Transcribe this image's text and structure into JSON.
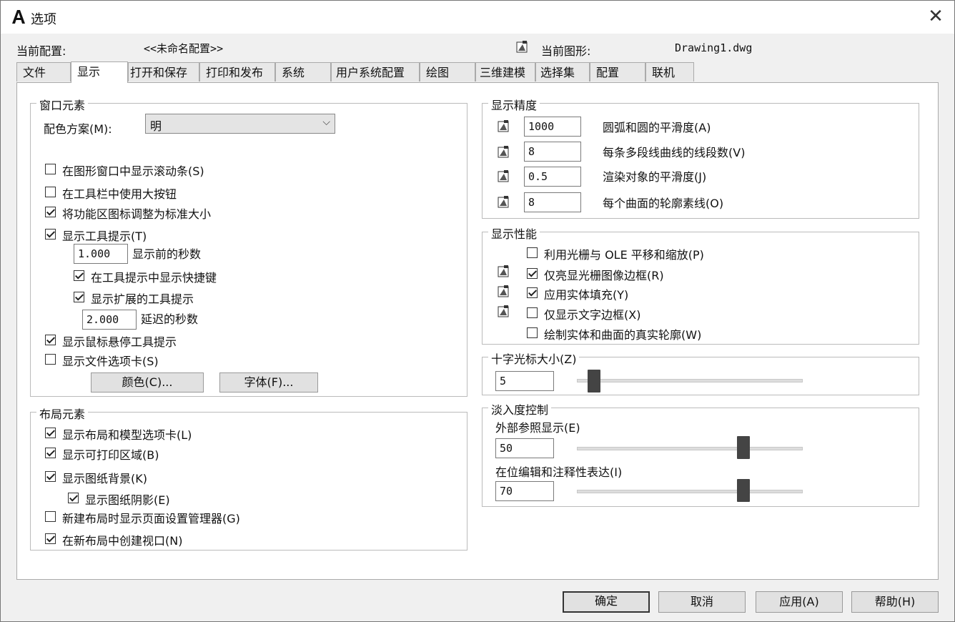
{
  "window": {
    "title": "选项",
    "close": "✕"
  },
  "profile": {
    "label": "当前配置:",
    "value": "<<未命名配置>>",
    "drawing_label": "当前图形:",
    "drawing_value": "Drawing1.dwg"
  },
  "tabs": [
    "文件",
    "显示",
    "打开和保存",
    "打印和发布",
    "系统",
    "用户系统配置",
    "绘图",
    "三维建模",
    "选择集",
    "配置",
    "联机"
  ],
  "active_tab": "显示",
  "window_elements": {
    "title": "窗口元素",
    "color_scheme_label": "配色方案(M):",
    "color_scheme_value": "明",
    "scrollbars": {
      "label": "在图形窗口中显示滚动条(S)",
      "checked": false
    },
    "large_buttons": {
      "label": "在工具栏中使用大按钮",
      "checked": false
    },
    "resize_ribbon_icons": {
      "label": "将功能区图标调整为标准大小",
      "checked": true
    },
    "tooltips": {
      "label": "显示工具提示(T)",
      "checked": true
    },
    "tooltip_delay_value": "1.000",
    "tooltip_delay_label": "显示前的秒数",
    "shortcut_keys": {
      "label": "在工具提示中显示快捷键",
      "checked": true
    },
    "extended_tooltips": {
      "label": "显示扩展的工具提示",
      "checked": true
    },
    "extended_delay_value": "2.000",
    "extended_delay_label": "延迟的秒数",
    "rollover_tooltips": {
      "label": "显示鼠标悬停工具提示",
      "checked": true
    },
    "file_tabs": {
      "label": "显示文件选项卡(S)",
      "checked": false
    },
    "colors_button": "颜色(C)...",
    "fonts_button": "字体(F)..."
  },
  "layout_elements": {
    "title": "布局元素",
    "layout_model_tabs": {
      "label": "显示布局和模型选项卡(L)",
      "checked": true
    },
    "printable_area": {
      "label": "显示可打印区域(B)",
      "checked": true
    },
    "paper_background": {
      "label": "显示图纸背景(K)",
      "checked": true
    },
    "paper_shadow": {
      "label": "显示图纸阴影(E)",
      "checked": true
    },
    "page_setup_manager": {
      "label": "新建布局时显示页面设置管理器(G)",
      "checked": false
    },
    "create_viewport": {
      "label": "在新布局中创建视口(N)",
      "checked": true
    }
  },
  "display_resolution": {
    "title": "显示精度",
    "arc_smoothness": {
      "value": "1000",
      "label": "圆弧和圆的平滑度(A)"
    },
    "polyline_segments": {
      "value": "8",
      "label": "每条多段线曲线的线段数(V)"
    },
    "rendered_smoothness": {
      "value": "0.5",
      "label": "渲染对象的平滑度(J)"
    },
    "contour_lines": {
      "value": "8",
      "label": "每个曲面的轮廓素线(O)"
    }
  },
  "display_performance": {
    "title": "显示性能",
    "raster_ole": {
      "label": "利用光栅与 OLE 平移和缩放(P)",
      "checked": false
    },
    "raster_frame": {
      "label": "仅亮显光栅图像边框(R)",
      "checked": true
    },
    "solid_fill": {
      "label": "应用实体填充(Y)",
      "checked": true
    },
    "text_boundary": {
      "label": "仅显示文字边框(X)",
      "checked": false
    },
    "silhouettes": {
      "label": "绘制实体和曲面的真实轮廓(W)",
      "checked": false
    }
  },
  "crosshair": {
    "title": "十字光标大小(Z)",
    "value": "5",
    "fraction": 0.05
  },
  "fade_control": {
    "title": "淡入度控制",
    "xref_label": "外部参照显示(E)",
    "xref_value": "50",
    "xref_fraction": 0.75,
    "inplace_label": "在位编辑和注释性表达(I)",
    "inplace_value": "70",
    "inplace_fraction": 0.75
  },
  "buttons": {
    "ok": "确定",
    "cancel": "取消",
    "apply": "应用(A)",
    "help": "帮助(H)"
  },
  "icons": {
    "app": "autocad-a-icon",
    "drawing": "drawing-saved-icon",
    "close": "close-icon",
    "dropdown": "chevron-down-icon"
  }
}
